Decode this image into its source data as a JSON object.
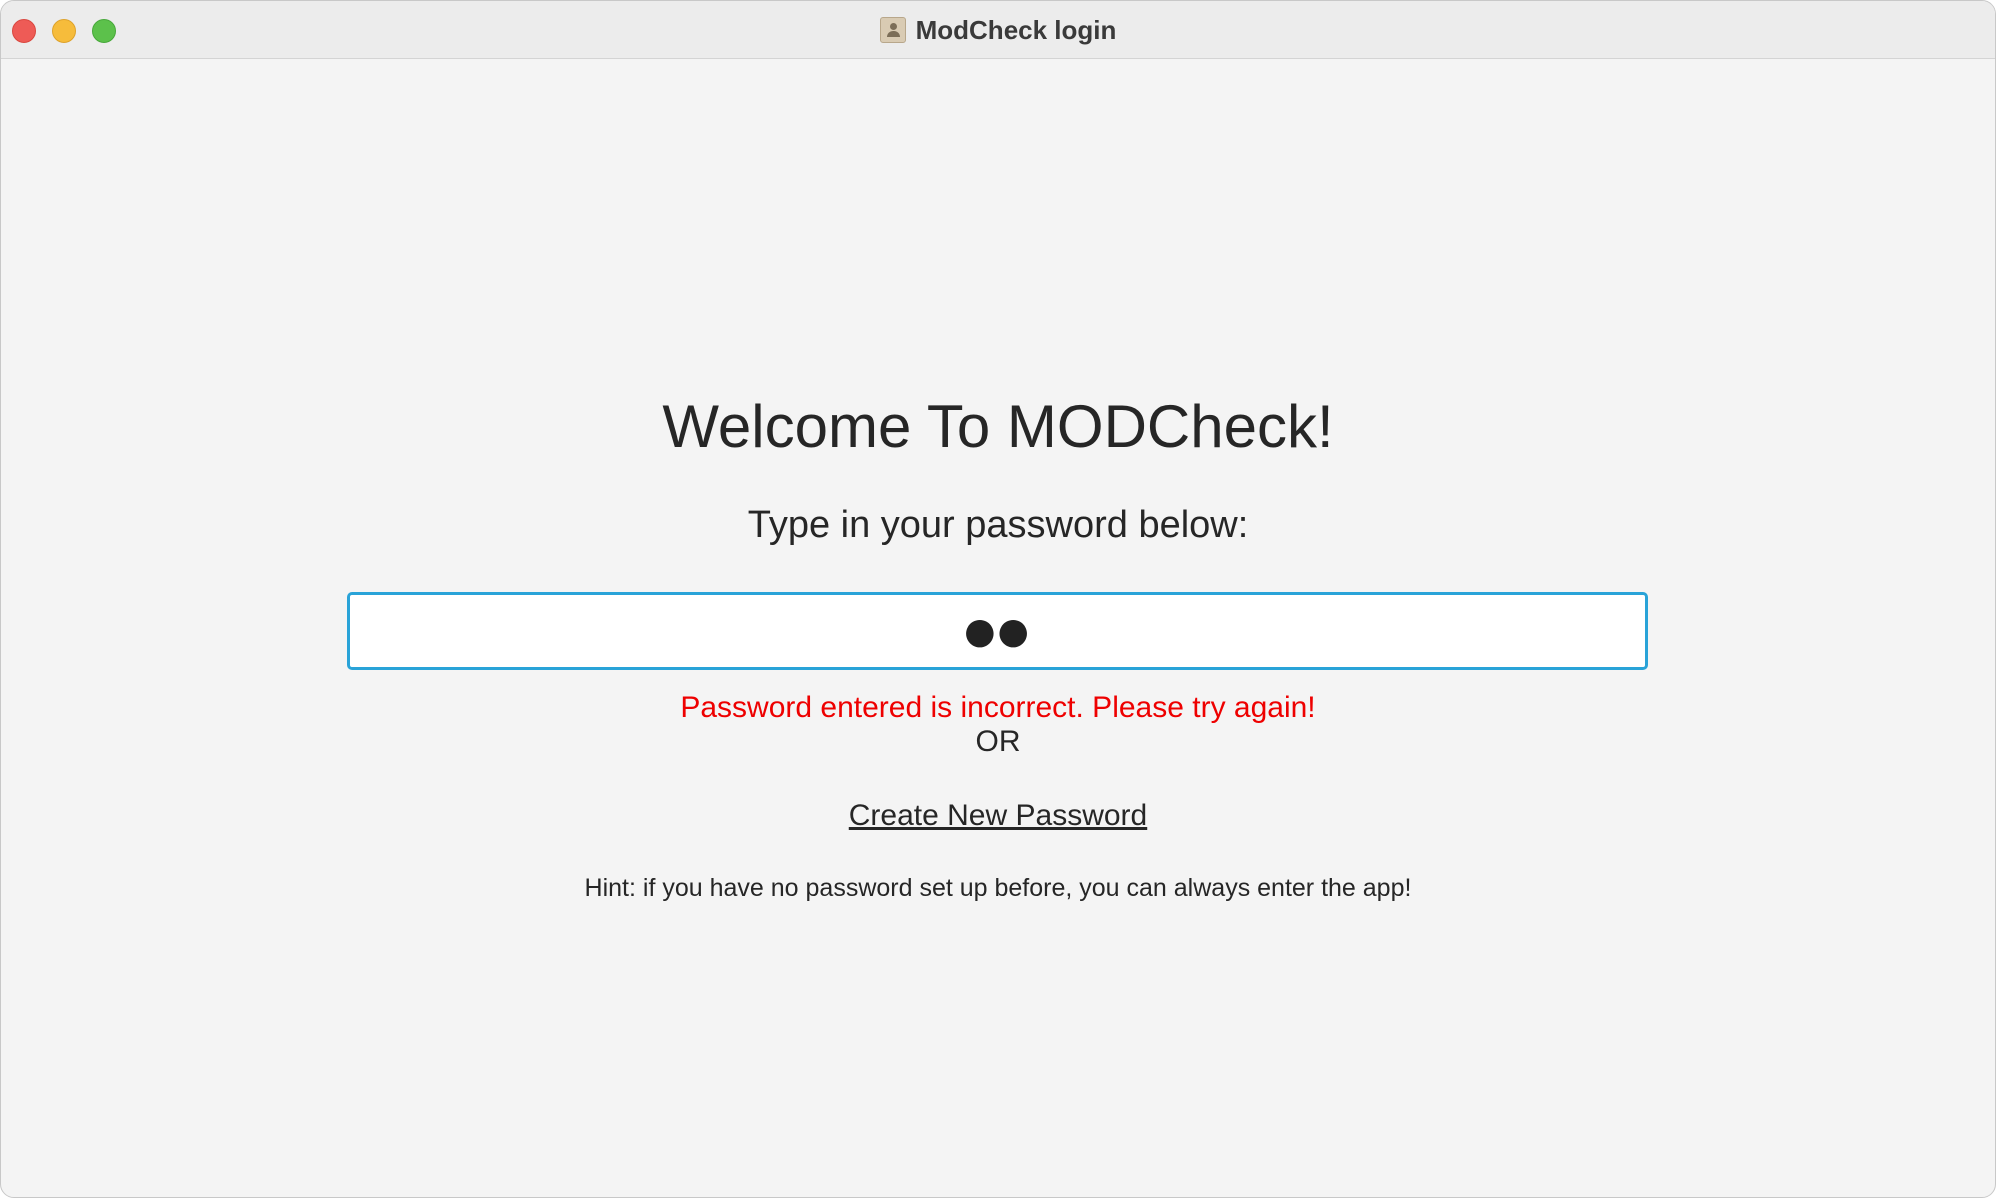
{
  "window": {
    "title": "ModCheck login",
    "icon": "contacts-app-icon"
  },
  "login": {
    "welcome": "Welcome To MODCheck!",
    "instruction": "Type in your password below:",
    "password_value": "●●",
    "error_message": "Password entered is incorrect. Please try again!",
    "or_text": "OR",
    "create_password_label": "Create New Password",
    "hint": "Hint: if you have no password set up before, you can always enter the app!"
  },
  "colors": {
    "error": "#ee0000",
    "focus_border": "#29a3d8",
    "close": "#ee5b56",
    "minimize": "#f6bc3b",
    "maximize": "#5cc14b"
  }
}
